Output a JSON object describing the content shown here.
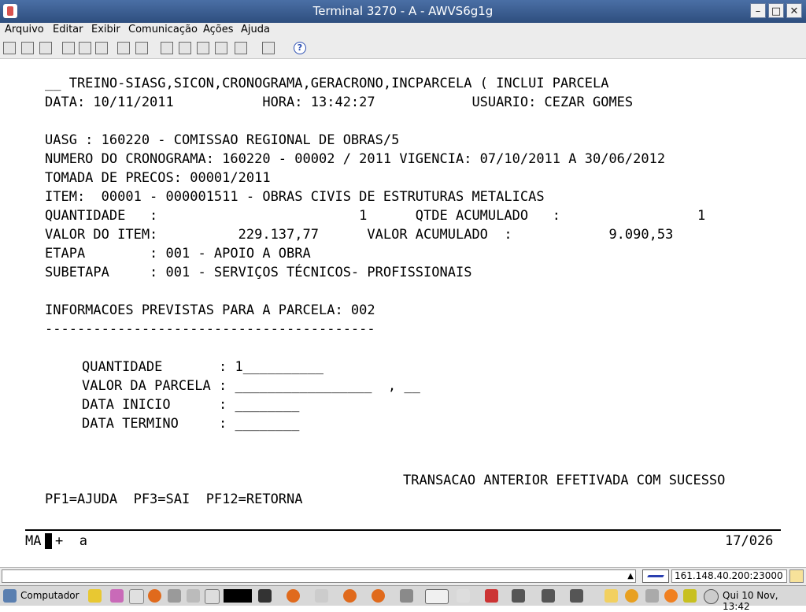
{
  "window": {
    "title": "Terminal 3270 - A - AWVS6g1g"
  },
  "menu": [
    "Arquivo",
    "Editar",
    "Exibir",
    "Comunicação",
    "Ações",
    "Ajuda"
  ],
  "terminal": {
    "l1": "__ TREINO-SIASG,SICON,CRONOGRAMA,GERACRONO,INCPARCELA ( INCLUI PARCELA",
    "l2": "DATA: 10/11/2011           HORA: 13:42:27            USUARIO: CEZAR GOMES",
    "l3": "UASG : 160220 - COMISSAO REGIONAL DE OBRAS/5",
    "l4": "NUMERO DO CRONOGRAMA: 160220 - 00002 / 2011 VIGENCIA: 07/10/2011 A 30/06/2012",
    "l5": "TOMADA DE PRECOS: 00001/2011",
    "l6": "ITEM:  00001 - 000001511 - OBRAS CIVIS DE ESTRUTURAS METALICAS",
    "l7": "QUANTIDADE   :                         1      QTDE ACUMULADO   :                 1",
    "l8": "VALOR DO ITEM:          229.137,77      VALOR ACUMULADO  :            9.090,53",
    "l9": "ETAPA        : 001 - APOIO A OBRA",
    "l10": "SUBETAPA     : 001 - SERVIÇOS TÉCNICOS- PROFISSIONAIS",
    "l11": "INFORMACOES PREVISTAS PARA A PARCELA: 002",
    "l12": "-----------------------------------------",
    "f1": "QUANTIDADE       : 1__________",
    "f2": "VALOR DA PARCELA : _________________  , __",
    "f3": "DATA INICIO      : ________",
    "f4": "DATA TERMINO     : ________",
    "msg": "TRANSACAO ANTERIOR EFETIVADA COM SUCESSO",
    "pf": "PF1=AJUDA  PF3=SAI  PF12=RETORNA",
    "oia_left_a": "MA",
    "oia_left_b": "+  a",
    "oia_right": "17/026"
  },
  "status": {
    "address": "161.148.40.200:23000"
  },
  "taskbar": {
    "start_label": "Computador",
    "clock": "Qui 10 Nov, 13:42"
  }
}
